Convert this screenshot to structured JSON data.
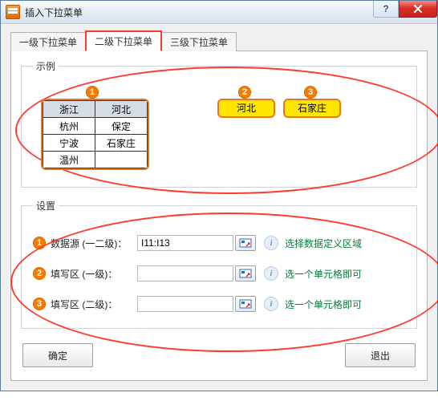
{
  "window": {
    "title": "插入下拉菜单"
  },
  "tabs": {
    "items": [
      {
        "label": "一级下拉菜单"
      },
      {
        "label": "二级下拉菜单"
      },
      {
        "label": "三级下拉菜单"
      }
    ],
    "active_index": 1
  },
  "group_example": {
    "legend": "示例",
    "markers": {
      "m1": "1",
      "m2": "2",
      "m3": "3"
    },
    "table": {
      "headers": [
        "浙江",
        "河北"
      ],
      "rows": [
        [
          "杭州",
          "保定"
        ],
        [
          "宁波",
          "石家庄"
        ],
        [
          "温州",
          ""
        ]
      ]
    },
    "yellow_cells": {
      "c2": "河北",
      "c3": "石家庄"
    }
  },
  "group_settings": {
    "legend": "设置",
    "rows": [
      {
        "marker": "1",
        "label": "数据源 (一二级)：",
        "value": "I11:I13",
        "hint": "选择数据定义区域"
      },
      {
        "marker": "2",
        "label": "填写区 (一级)：",
        "value": "",
        "hint": "选一个单元格即可"
      },
      {
        "marker": "3",
        "label": "填写区 (二级)：",
        "value": "",
        "hint": "选一个单元格即可"
      }
    ]
  },
  "footer": {
    "ok": "确定",
    "cancel": "退出"
  }
}
